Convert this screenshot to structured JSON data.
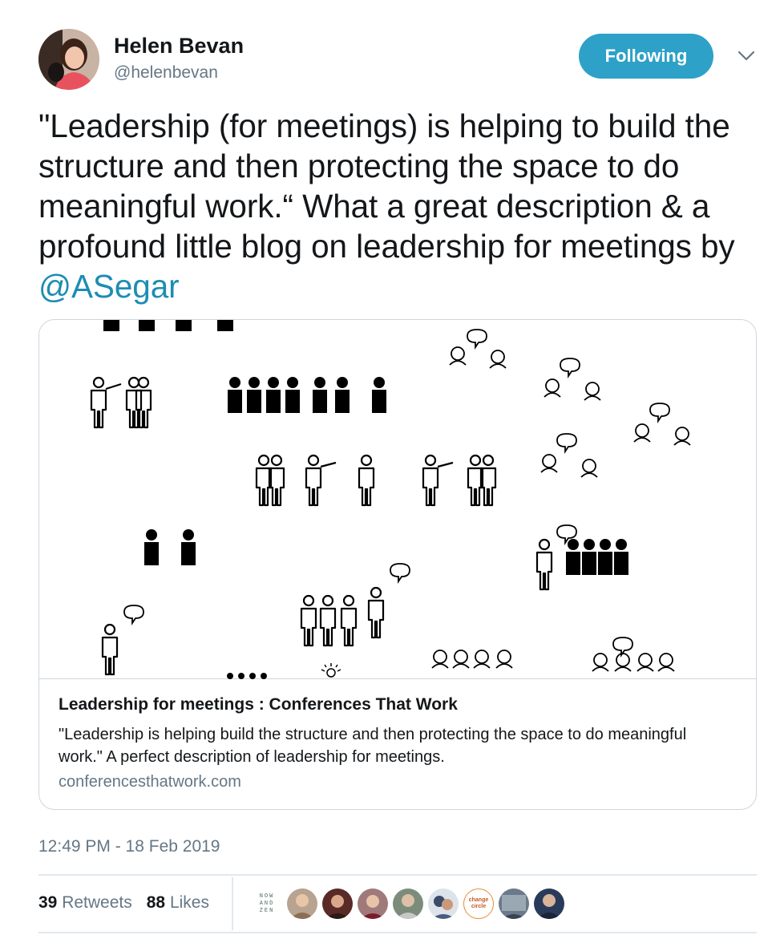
{
  "author": {
    "name": "Helen Bevan",
    "handle": "@helenbevan"
  },
  "follow_button": {
    "label": "Following"
  },
  "tweet": {
    "text_before": "\"Leadership (for meetings) is helping to build the structure and then protecting the space to do meaningful work.“ What a great description & a profound little blog on leadership for meetings by ",
    "mention": "@ASegar"
  },
  "card": {
    "title": "Leadership for meetings : Conferences That Work",
    "description": "\"Leadership is helping build the structure and then protecting the space to do meaningful work.\" A perfect description of leadership for meetings.",
    "domain": "conferencesthatwork.com"
  },
  "timestamp": "12:49 PM - 18 Feb 2019",
  "stats": {
    "retweets_count": "39",
    "retweets_label": "Retweets",
    "likes_count": "88",
    "likes_label": "Likes"
  },
  "likers": {
    "nowandzen": [
      "NOW",
      "AND",
      "ZEN"
    ],
    "changecircle": [
      "change",
      "circle"
    ]
  },
  "colors": {
    "follow_button": "#2da1c7",
    "mention": "#1d8db3",
    "secondary_text": "#657786"
  }
}
